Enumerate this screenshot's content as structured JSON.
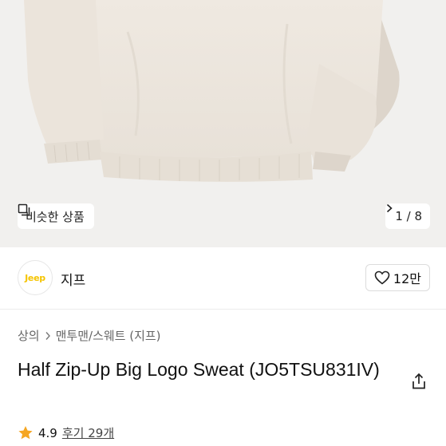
{
  "gallery": {
    "similar_label": "비슷한 상품",
    "page_counter": "1 / 8"
  },
  "brand": {
    "logo_text": "Jeep",
    "name": "지프",
    "like_count": "12만"
  },
  "breadcrumb": [
    "상의",
    "맨투맨/스웨트 (지프)"
  ],
  "product": {
    "title": "Half Zip-Up Big Logo Sweat (JO5TSU831IV)"
  },
  "rating": {
    "score": "4.9",
    "reviews": "후기 29개"
  },
  "colors": {
    "brand_logo": "#f5c400",
    "star": "#f5a623",
    "hero_bg": "#f1f0ee"
  }
}
